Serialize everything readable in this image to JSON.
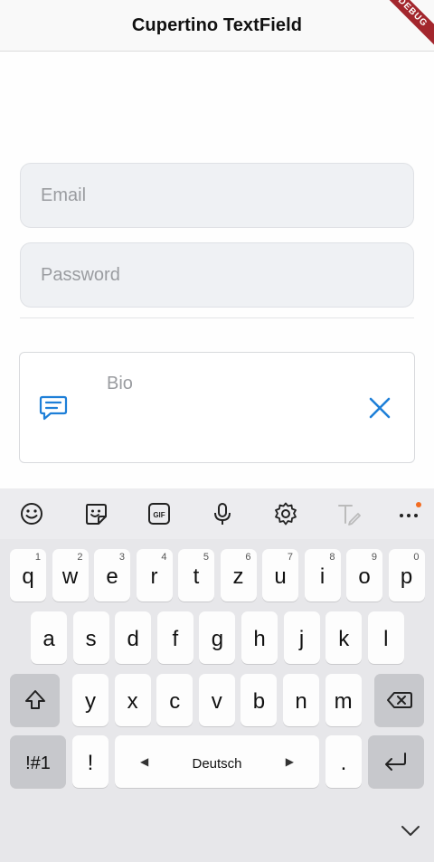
{
  "navbar": {
    "title": "Cupertino TextField",
    "debug_banner": "DEBUG"
  },
  "form": {
    "email_placeholder": "Email",
    "password_placeholder": "Password",
    "bio_placeholder": "Bio"
  },
  "colors": {
    "accent": "#1e7fd8",
    "field_bg": "#eff1f4",
    "debug": "#a3262d"
  },
  "keyboard": {
    "toolbar_icons": [
      "emoji-icon",
      "sticker-icon",
      "gif-icon",
      "mic-icon",
      "settings-icon",
      "text-edit-icon",
      "more-icon"
    ],
    "gif_label": "GIF",
    "row1": [
      "q",
      "w",
      "e",
      "r",
      "t",
      "z",
      "u",
      "i",
      "o",
      "p"
    ],
    "row1_hints": [
      "1",
      "2",
      "3",
      "4",
      "5",
      "6",
      "7",
      "8",
      "9",
      "0"
    ],
    "row2": [
      "a",
      "s",
      "d",
      "f",
      "g",
      "h",
      "j",
      "k",
      "l"
    ],
    "row3": [
      "y",
      "x",
      "c",
      "v",
      "b",
      "n",
      "m"
    ],
    "symbols_label": "!#1",
    "excl_label": "!",
    "space_label": "Deutsch",
    "period_label": ".",
    "left_arrow": "◀",
    "right_arrow": "▶"
  }
}
